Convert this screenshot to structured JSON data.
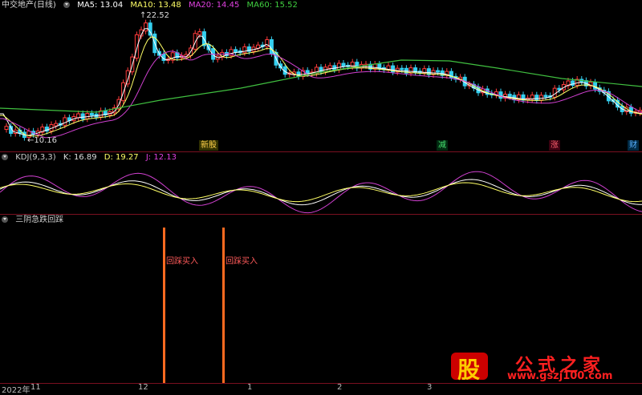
{
  "main": {
    "title": "中交地产(日线)",
    "ma5": "MA5: 13.04",
    "ma10": "MA10: 13.48",
    "ma20": "MA20: 14.45",
    "ma60": "MA60: 15.52",
    "high_label": "22.52",
    "low_label": "10.16",
    "tags": [
      "新股",
      "减",
      "涨",
      "财"
    ]
  },
  "kdj": {
    "name": "KDJ(9,3,3)",
    "k": "K: 16.89",
    "d": "D: 19.27",
    "j": "J: 12.13"
  },
  "signal": {
    "name": "三阴急跌回踩",
    "labels": [
      "回踩买入",
      "回踩买入"
    ]
  },
  "axis": {
    "labels": [
      "2022年",
      "11",
      "12",
      "1",
      "2",
      "3"
    ]
  },
  "watermark": {
    "big": "股",
    "title": "公式之家",
    "url": "www.gszj100.com"
  },
  "colors": {
    "up": "#ff3b3b",
    "down": "#35d0f0",
    "ma5": "#ffffff",
    "ma10": "#ffff66",
    "ma20": "#d040d0",
    "ma60": "#40c040"
  }
}
